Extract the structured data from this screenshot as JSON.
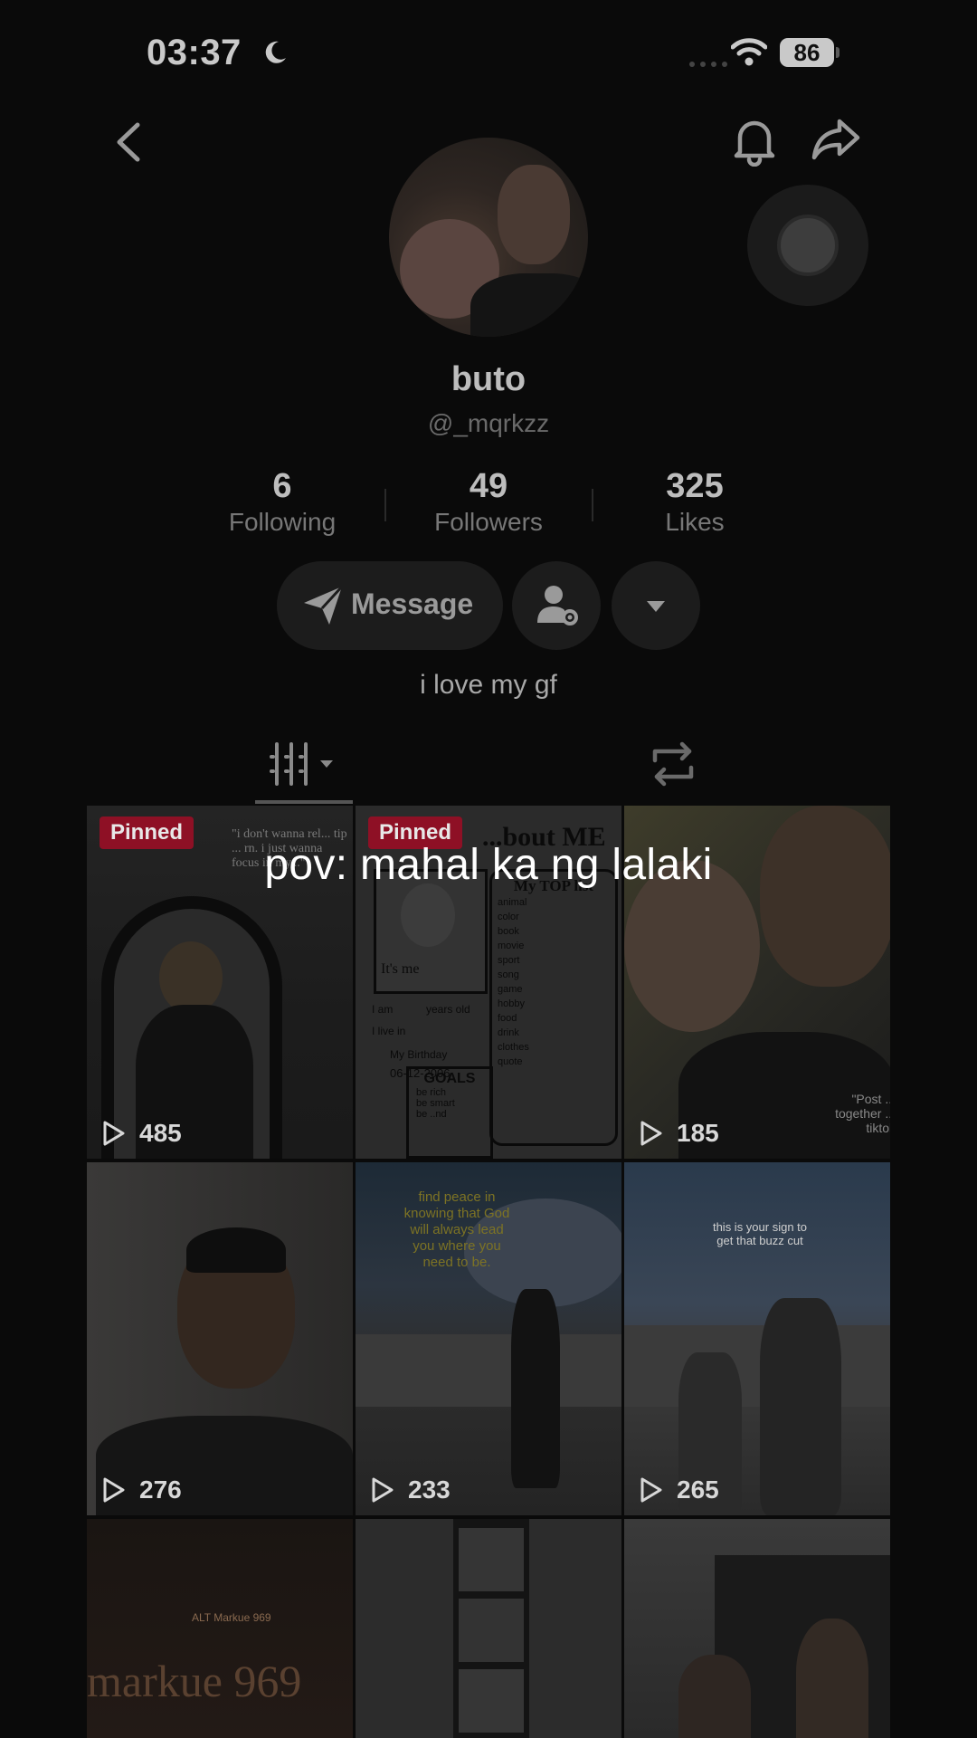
{
  "status_bar": {
    "time": "03:37",
    "battery": "86"
  },
  "icons": {
    "moon": "moon-icon",
    "signal": "cellular-signal-icon",
    "wifi": "wifi-icon",
    "back": "chevron-left-icon",
    "bell": "bell-icon",
    "share": "share-arrow-icon",
    "message": "paper-plane-icon",
    "person_settings": "person-gear-icon",
    "more": "caret-down-icon",
    "videos_tab": "grid-columns-icon",
    "reposts_tab": "repost-icon",
    "play": "play-icon"
  },
  "profile": {
    "display_name": "buto",
    "username": "@_mqrkzz",
    "bio": "i love my gf"
  },
  "stats": {
    "following": {
      "value": "6",
      "label": "Following"
    },
    "followers": {
      "value": "49",
      "label": "Followers"
    },
    "likes": {
      "value": "325",
      "label": "Likes"
    }
  },
  "actions": {
    "message_label": "Message"
  },
  "overlay_caption": "pov: mahal ka ng lalaki",
  "videos": [
    {
      "pinned": "Pinned",
      "views": "485"
    },
    {
      "pinned": "Pinned",
      "views": ""
    },
    {
      "views": "185"
    },
    {
      "views": "276"
    },
    {
      "views": "233"
    },
    {
      "views": "265"
    },
    {
      "views": ""
    },
    {
      "views": ""
    },
    {
      "views": ""
    }
  ],
  "tile_texts": {
    "t0_top": "\"i don't wanna rel... tip ... rn. i just wanna focus in my...\"",
    "t1_title": "...bout ME",
    "t1_itsme": "It's me",
    "t1_toplist": "My TOP list",
    "t1_list": [
      "animal",
      "color",
      "book",
      "movie",
      "sport",
      "song",
      "game",
      "hobby",
      "food",
      "drink",
      "clothes",
      "quote"
    ],
    "t1_fields": [
      "I am",
      "years old",
      "I live in",
      "My Birthday",
      "06-12-2006"
    ],
    "t1_goals": "GOALS",
    "t1_goal_items": [
      "be rich",
      "be smart",
      "be ..nd"
    ],
    "t2_text": "\"Post ... together ... tiktok",
    "t4_text": "find peace in knowing that God will always lead you where you need to be.",
    "t5_text": "this is your sign to get that buzz cut",
    "t6_text": "markue 969",
    "t6_sub": "ALT Markue 969"
  },
  "colors": {
    "background": "#0a0a0a",
    "pinned_badge": "#8e1025",
    "button_bg": "#1c1c1c"
  }
}
